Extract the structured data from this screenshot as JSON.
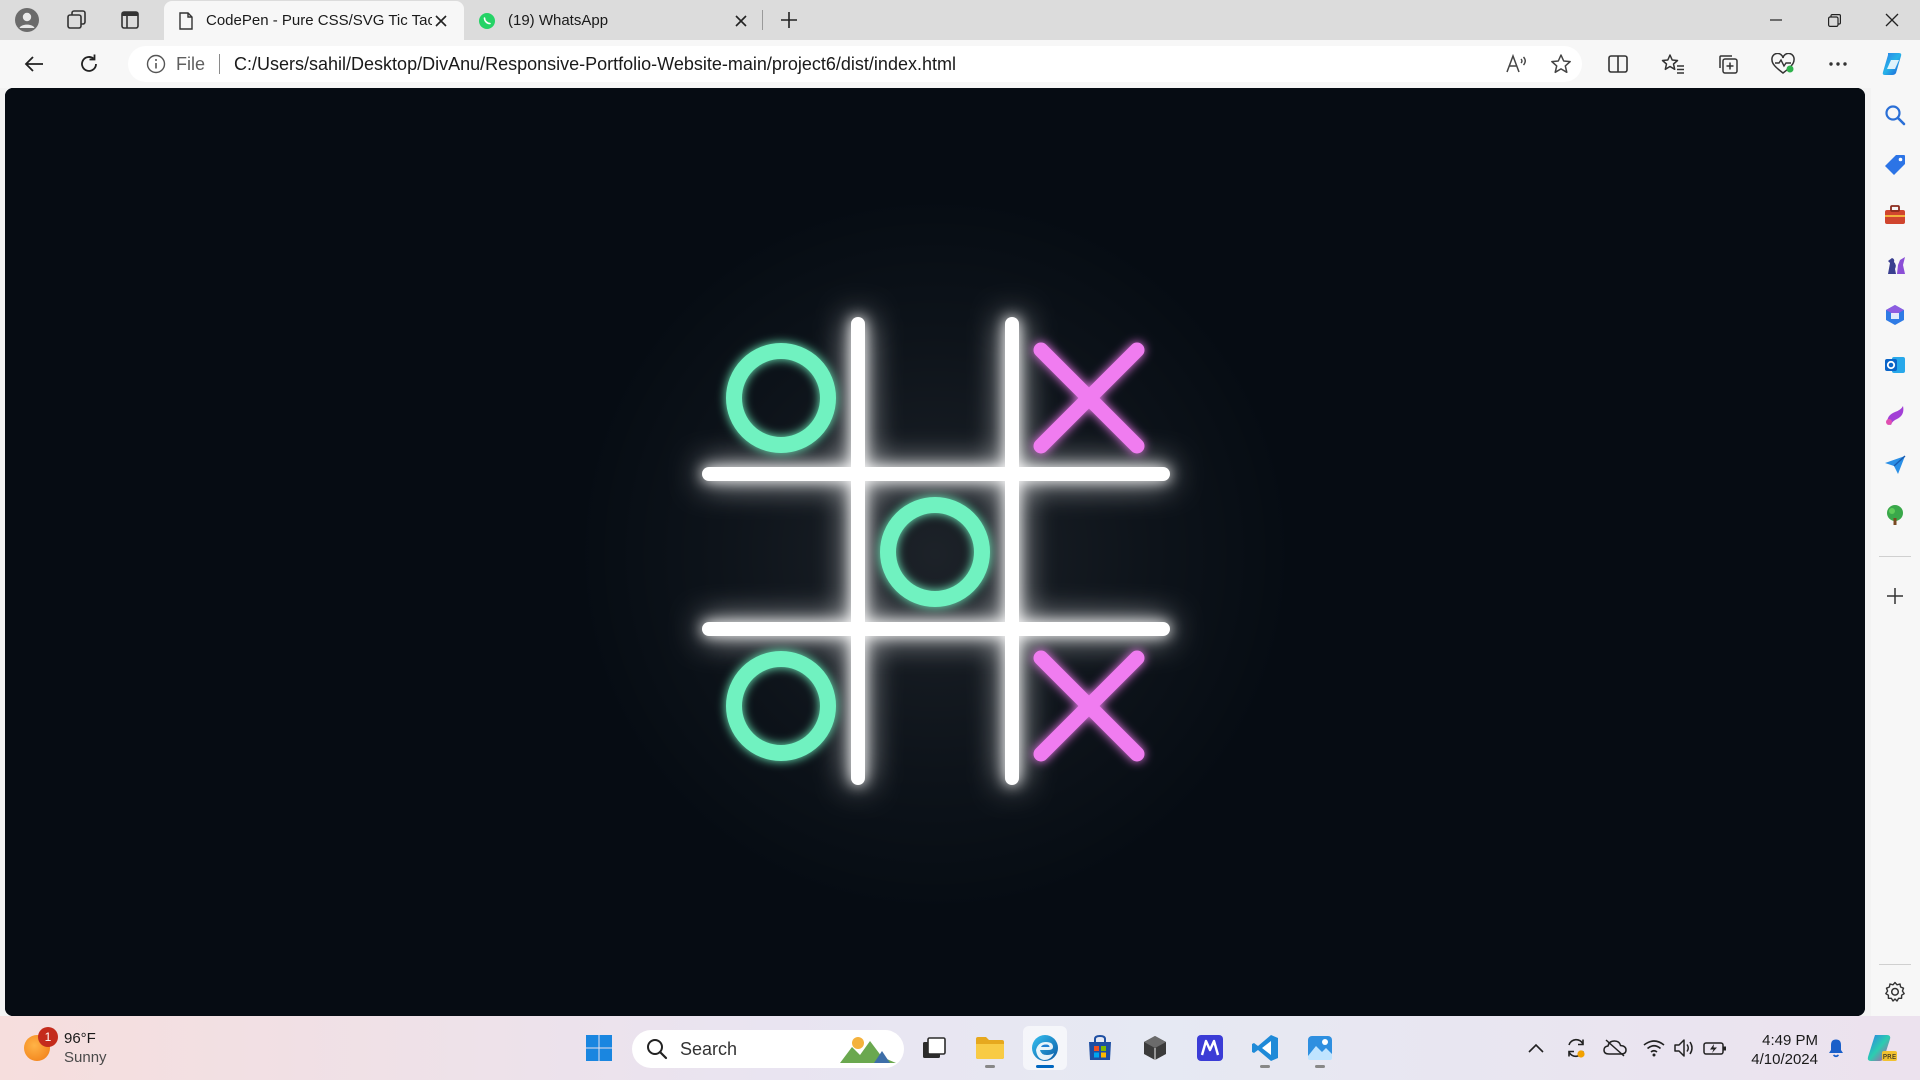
{
  "browser": {
    "tabs": [
      {
        "title": "CodePen - Pure CSS/SVG Tic Tac",
        "active": true,
        "icon": "page-icon"
      },
      {
        "title": "(19) WhatsApp",
        "active": false,
        "icon": "whatsapp-icon"
      }
    ],
    "address": {
      "scheme_label": "File",
      "url": "C:/Users/sahil/Desktop/DivAnu/Responsive-Portfolio-Website-main/project6/dist/index.html"
    }
  },
  "game": {
    "board": [
      [
        "O",
        "",
        "X"
      ],
      [
        "",
        "O",
        ""
      ],
      [
        "O",
        "",
        "X"
      ]
    ],
    "colors": {
      "background": "#060c13",
      "grid": "#ffffff",
      "o": "#6ff2c0",
      "x": "#f07bf0"
    }
  },
  "sidebar": {
    "items": [
      "search-icon",
      "shopping-tag-icon",
      "toolbox-icon",
      "games-icon",
      "microsoft-365-icon",
      "outlook-icon",
      "designer-icon",
      "send-icon",
      "tree-icon",
      "add-icon",
      "settings-icon"
    ]
  },
  "taskbar": {
    "weather": {
      "temp": "96°F",
      "condition": "Sunny",
      "badge": "1"
    },
    "search_placeholder": "Search",
    "clock": {
      "time": "4:49 PM",
      "date": "4/10/2024"
    }
  }
}
